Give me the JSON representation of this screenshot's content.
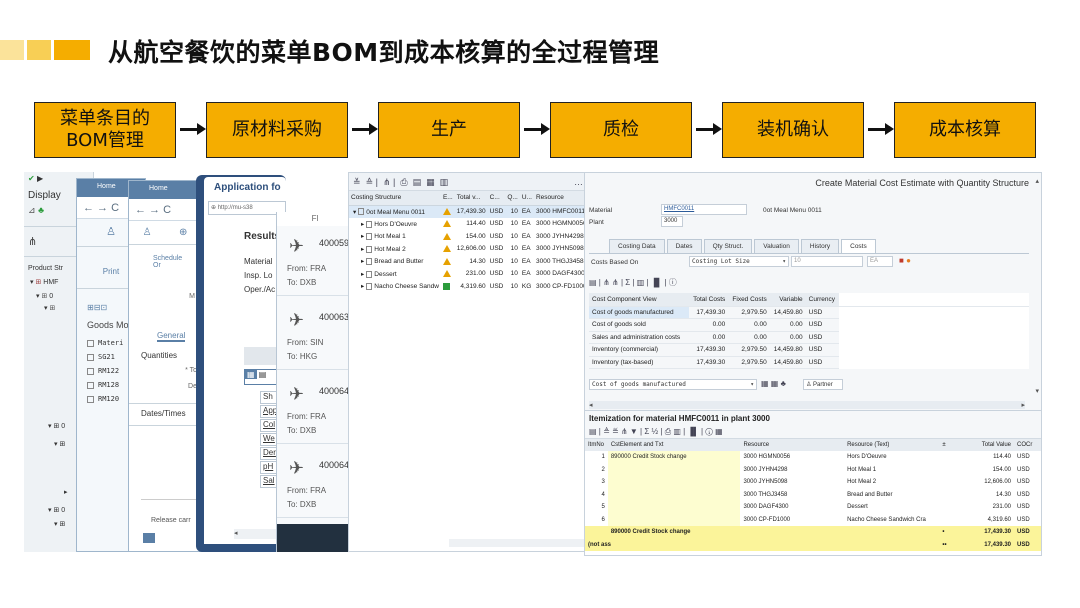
{
  "slide": {
    "title": "从航空餐饮的菜单BOM到成本核算的全过程管理",
    "accent_colors": [
      "#fbe39a",
      "#f8cf55",
      "#f5ad00"
    ]
  },
  "flow": {
    "steps": [
      "菜单条目的\nBOM管理",
      "原材料采购",
      "生产",
      "质检",
      "装机确认",
      "成本核算"
    ],
    "box_color": "#f5ad00"
  },
  "win_explorer": {
    "title": "Display",
    "product_label": "Product Str",
    "tree_prefix": "HMF"
  },
  "win_browser1": {
    "tab": "Home",
    "nav": "← →  C",
    "print": "Print",
    "goods": "Goods Mo",
    "items": [
      "Materi",
      "SG21",
      "RM122",
      "RM128",
      "RM120"
    ]
  },
  "win_browser2": {
    "tab": "Home",
    "nav": "← →  C",
    "schedule": "Schedule Or",
    "general": "General",
    "quantities": "Quantities",
    "to": "* To",
    "de": "De",
    "dates": "Dates/Times",
    "release": "Release carr"
  },
  "win_app": {
    "title": "Application fo",
    "url": "http://mu-s38",
    "results": "Results",
    "rows": [
      "Material",
      "Insp. Lo",
      "Oper./Ac"
    ],
    "sub": [
      "Sh",
      "App",
      "Col",
      "We",
      "Der",
      "pH",
      "Sal"
    ]
  },
  "win_flights": {
    "header": "Fl",
    "flights": [
      {
        "num": "400059",
        "from": "From: FRA",
        "to": "To: DXB"
      },
      {
        "num": "400063",
        "from": "From: SIN",
        "to": "To: HKG"
      },
      {
        "num": "400064",
        "from": "From: FRA",
        "to": "To: DXB"
      },
      {
        "num": "400064",
        "from": "From: FRA",
        "to": "To: DXB"
      }
    ]
  },
  "win_costing": {
    "headers": [
      "Costing Structure",
      "E...",
      "Total v...",
      "C...",
      "Q...",
      "U...",
      "Resource"
    ],
    "rows": [
      {
        "name": "0ot Meal Menu 0011",
        "total": "17,439.30",
        "cur": "USD",
        "qty": "10",
        "unit": "EA",
        "res": "3000 HMFC0011",
        "flag": "warn"
      },
      {
        "name": "Hors D'Oeuvre",
        "total": "114.40",
        "cur": "USD",
        "qty": "10",
        "unit": "EA",
        "res": "3000 HGMN0056",
        "flag": "warn"
      },
      {
        "name": "Hot Meal 1",
        "total": "154.00",
        "cur": "USD",
        "qty": "10",
        "unit": "EA",
        "res": "3000 JYHN4298",
        "flag": "warn"
      },
      {
        "name": "Hot Meal 2",
        "total": "12,606.00",
        "cur": "USD",
        "qty": "10",
        "unit": "EA",
        "res": "3000 JYHN5098",
        "flag": "warn"
      },
      {
        "name": "Bread and Butter",
        "total": "14.30",
        "cur": "USD",
        "qty": "10",
        "unit": "EA",
        "res": "3000 THGJ3458",
        "flag": "warn"
      },
      {
        "name": "Dessert",
        "total": "231.00",
        "cur": "USD",
        "qty": "10",
        "unit": "EA",
        "res": "3000 DAGF4300",
        "flag": "warn"
      },
      {
        "name": "Nacho Cheese Sandw",
        "total": "4,319.60",
        "cur": "USD",
        "qty": "10",
        "unit": "KG",
        "res": "3000 CP-FD1000",
        "flag": "ok"
      }
    ]
  },
  "win_estimate": {
    "title": "Create Material Cost Estimate with Quantity Structure",
    "material_label": "Material",
    "material_value": "HMFC0011",
    "material_desc": "0ot Meal Menu 0011",
    "plant_label": "Plant",
    "plant_value": "3000",
    "tabs": [
      "Costing Data",
      "Dates",
      "Qty Struct.",
      "Valuation",
      "History",
      "Costs"
    ],
    "costs_based_label": "Costs Based On",
    "costs_based_value": "Costing Lot Size",
    "lot_value": "10",
    "lot_unit": "EA",
    "col_headers": [
      "Cost Component View",
      "Total Costs",
      "Fixed Costs",
      "Variable",
      "Currency"
    ],
    "rows": [
      [
        "Cost of goods manufactured",
        "17,439.30",
        "2,979.50",
        "14,459.80",
        "USD"
      ],
      [
        "Cost of goods sold",
        "0.00",
        "0.00",
        "0.00",
        "USD"
      ],
      [
        "Sales and administration costs",
        "0.00",
        "0.00",
        "0.00",
        "USD"
      ],
      [
        "Inventory (commercial)",
        "17,439.30",
        "2,979.50",
        "14,459.80",
        "USD"
      ],
      [
        "Inventory (tax-based)",
        "17,439.30",
        "2,979.50",
        "14,459.80",
        "USD"
      ]
    ],
    "view_select": "Cost of goods manufactured",
    "partner_label": "Partner"
  },
  "win_items": {
    "title": "Itemization for material HMFC0011 in plant 3000",
    "col_headers": [
      "ItmNo",
      "CstElement and Txt",
      "Resource",
      "Resource (Text)",
      "±",
      "Total Value",
      "COCr"
    ],
    "credit_text": "890000  Credit Stock change",
    "rows": [
      [
        "1",
        "3000 HGMN0056",
        "Hors D'Oeuvre",
        "114.40",
        "USD"
      ],
      [
        "2",
        "3000 JYHN4298",
        "Hot Meal 1",
        "154.00",
        "USD"
      ],
      [
        "3",
        "3000 JYHN5098",
        "Hot Meal 2",
        "12,606.00",
        "USD"
      ],
      [
        "4",
        "3000 THGJ3458",
        "Bread and Butter",
        "14.30",
        "USD"
      ],
      [
        "5",
        "3000 DAGF4300",
        "Dessert",
        "231.00",
        "USD"
      ],
      [
        "6",
        "3000 CP-FD1000",
        "Nacho Cheese Sandwich Cra",
        "4,319.60",
        "USD"
      ]
    ],
    "subtotal": {
      "text": "890000  Credit Stock change",
      "value": "17,439.30",
      "cur": "USD"
    },
    "total": {
      "label": "(not ass",
      "value": "17,439.30",
      "cur": "USD"
    }
  }
}
